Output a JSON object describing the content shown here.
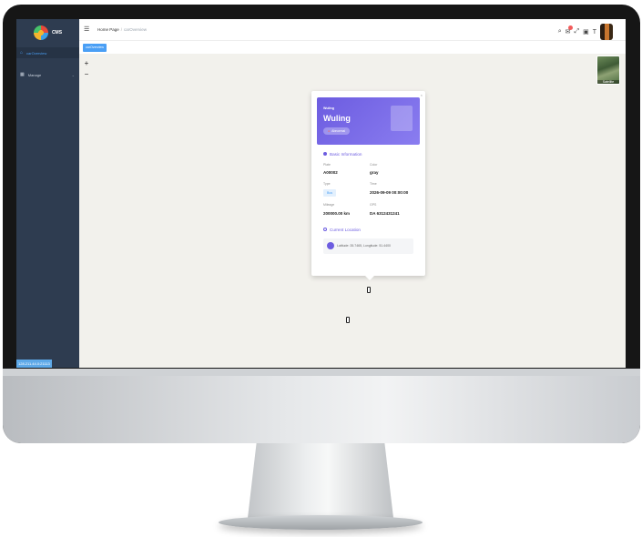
{
  "app": {
    "name": "CMS"
  },
  "sidebar": {
    "items": [
      {
        "label": "carOverview",
        "icon": "home-icon",
        "active": true
      },
      {
        "label": "Manage",
        "icon": "grid-icon",
        "active": false
      }
    ],
    "ip_address": "128.211.44.0:21113"
  },
  "header": {
    "breadcrumb": {
      "home": "Home Page",
      "separator": "/",
      "current": "carOverview"
    }
  },
  "tags": [
    {
      "label": "carOverview",
      "active": true
    }
  ],
  "map": {
    "zoom_in_label": "+",
    "zoom_out_label": "−",
    "layer_label": "Satellite"
  },
  "vehicle_popup": {
    "brand_small": "Wuling",
    "brand_large": "Wuling",
    "status": "Abnormal",
    "basic_info_title": "Basic Information",
    "fields": {
      "plate_label": "Plate",
      "plate_value": "A00002",
      "color_label": "Color",
      "color_value": "gray",
      "type_label": "Type",
      "type_value": "Bus",
      "time_label": "Time",
      "time_value": "2026-09-09 00:00:00",
      "mileage_label": "Mileage",
      "mileage_value": "200000.00 km",
      "gps_label": "GPS",
      "gps_value": "DA 6312431241"
    },
    "location_title": "Current Location",
    "location_text": "Latitude: 35.7465, Longitude: 51.4400"
  },
  "colors": {
    "sidebar_bg": "#2e3c50",
    "accent": "#4a9ff5",
    "card_purple": "#6c5ce0",
    "map_bg": "#f2f1ec"
  }
}
